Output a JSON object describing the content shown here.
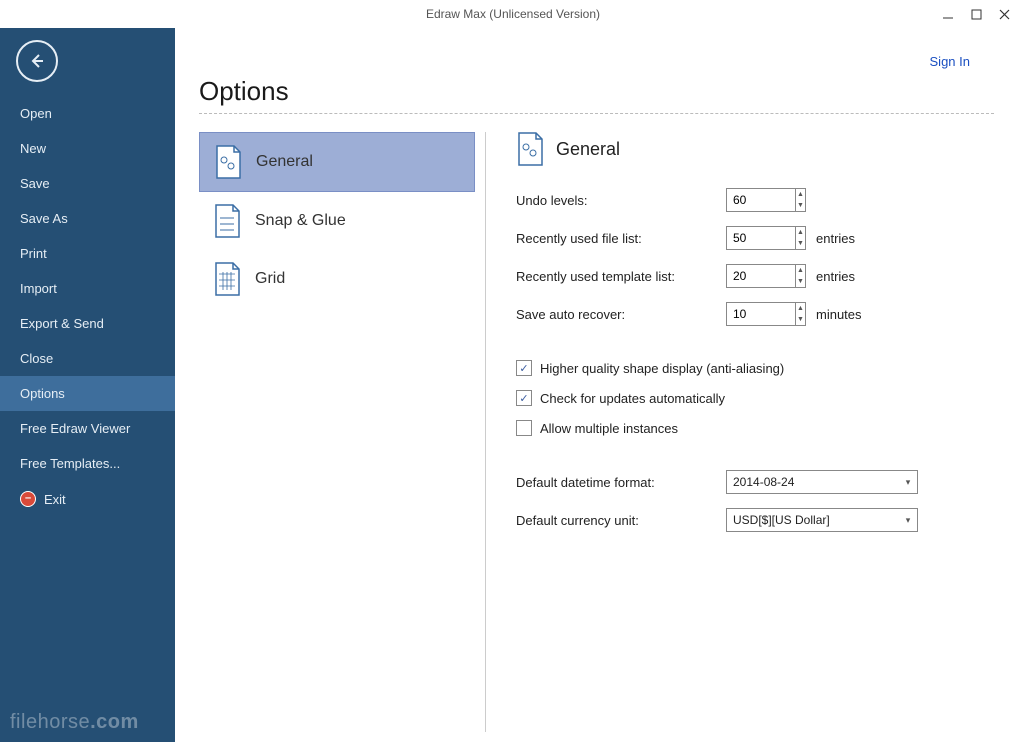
{
  "titlebar": {
    "title": "Edraw Max (Unlicensed Version)"
  },
  "header": {
    "signin": "Sign In"
  },
  "sidebar": {
    "items": [
      "Open",
      "New",
      "Save",
      "Save As",
      "Print",
      "Import",
      "Export & Send",
      "Close",
      "Options",
      "Free Edraw Viewer",
      "Free Templates...",
      "Exit"
    ]
  },
  "watermark": {
    "a": "filehorse",
    "b": ".com"
  },
  "main": {
    "title": "Options",
    "tabs": [
      "General",
      "Snap & Glue",
      "Grid"
    ]
  },
  "general": {
    "title": "General",
    "fields": [
      {
        "label": "Undo levels:",
        "value": "60"
      },
      {
        "label": "Recently used file list:",
        "value": "50",
        "suffix": "entries"
      },
      {
        "label": "Recently used template list:",
        "value": "20",
        "suffix": "entries"
      },
      {
        "label": "Save auto recover:",
        "value": "10",
        "suffix": "minutes"
      }
    ],
    "checks": [
      {
        "label": "Higher quality shape display (anti-aliasing)",
        "checked": true,
        "mark": "✓"
      },
      {
        "label": "Check for updates automatically",
        "checked": true,
        "mark": "✓"
      },
      {
        "label": "Allow multiple instances",
        "checked": false,
        "mark": ""
      }
    ],
    "combos": [
      {
        "label": "Default datetime format:",
        "value": "2014-08-24"
      },
      {
        "label": "Default currency unit:",
        "value": "USD[$][US Dollar]"
      }
    ]
  }
}
